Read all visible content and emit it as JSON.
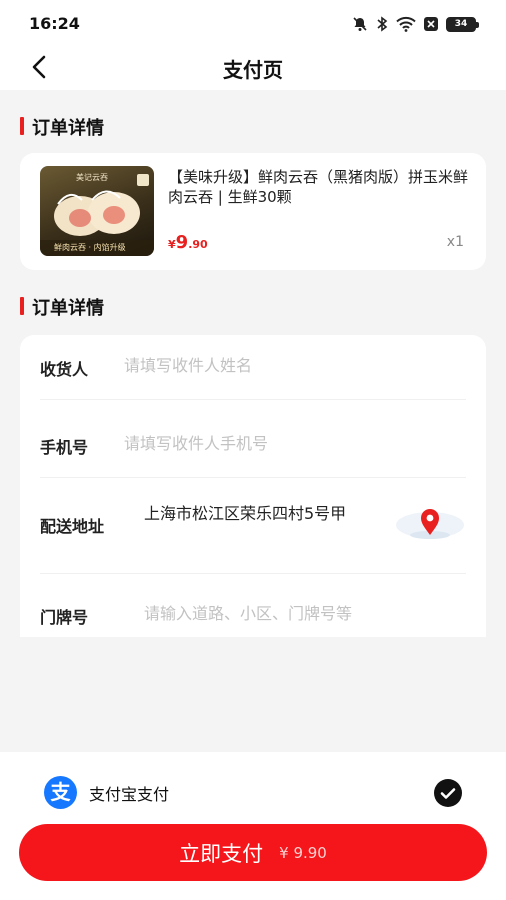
{
  "status_bar": {
    "time": "16:24",
    "battery": "34"
  },
  "nav": {
    "title": "支付页"
  },
  "order_section": {
    "title": "订单详情"
  },
  "product": {
    "thumb_caption": "鲜肉云吞 · 内馅升级",
    "thumb_brand": "美记云吞",
    "name": "【美味升级】鲜肉云吞（黑猪肉版）拼玉米鲜肉云吞 | 生鲜30颗",
    "price_symbol": "¥",
    "price_int": "9",
    "price_dec": ".90",
    "quantity": "x1"
  },
  "address_section": {
    "title": "订单详情"
  },
  "form": {
    "receiver_label": "收货人",
    "receiver_placeholder": "请填写收件人姓名",
    "phone_label": "手机号",
    "phone_placeholder": "请填写收件人手机号",
    "address_label": "配送地址",
    "address_value": "上海市松江区荣乐四村5号甲",
    "door_label": "门牌号",
    "door_placeholder": "请输入道路、小区、门牌号等"
  },
  "payment": {
    "method_label": "支付宝支付",
    "alipay_glyph": "支",
    "pay_label": "立即支付",
    "pay_amount": "¥ 9.90"
  },
  "colors": {
    "accent": "#e8201f",
    "pay_button": "#f4161b",
    "alipay": "#1677ff"
  }
}
